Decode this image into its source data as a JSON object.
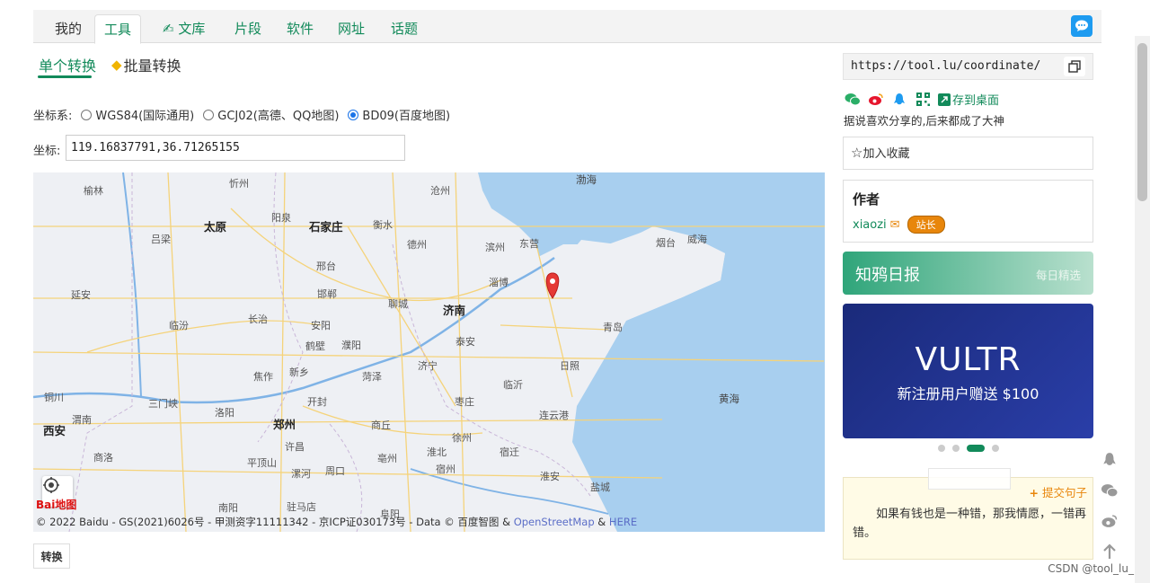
{
  "nav": {
    "tabs": [
      {
        "label": "我的",
        "state": "plain"
      },
      {
        "label": "工具",
        "state": "active"
      },
      {
        "label": "文库",
        "state": "link"
      },
      {
        "label": "片段",
        "state": "link"
      },
      {
        "label": "软件",
        "state": "link"
      },
      {
        "label": "网址",
        "state": "link"
      },
      {
        "label": "话题",
        "state": "link"
      }
    ]
  },
  "subtabs": {
    "single": "单个转换",
    "batch": "批量转换"
  },
  "coord_system": {
    "label": "坐标系:",
    "options": [
      {
        "label": "WGS84(国际通用)",
        "checked": false
      },
      {
        "label": "GCJ02(高德、QQ地图)",
        "checked": false
      },
      {
        "label": "BD09(百度地图)",
        "checked": true
      }
    ]
  },
  "coord": {
    "label": "坐标:",
    "value": "119.16837791,36.71265155"
  },
  "map": {
    "cities_major": [
      "太原",
      "石家庄",
      "济南",
      "郑州",
      "西安"
    ],
    "cities": [
      "榆林",
      "忻州",
      "阳泉",
      "衡水",
      "沧州",
      "德州",
      "滨州",
      "东营",
      "烟台",
      "威海",
      "吕梁",
      "邢台",
      "淄博",
      "延安",
      "临汾",
      "长治",
      "邯郸",
      "聊城",
      "安阳",
      "青岛",
      "鹤壁",
      "濮阳",
      "日照",
      "泰安",
      "济宁",
      "焦作",
      "新乡",
      "菏泽",
      "临沂",
      "铜川",
      "三门峡",
      "洛阳",
      "开封",
      "枣庄",
      "渭南",
      "商丘",
      "连云港",
      "淮北",
      "徐州",
      "宿迁",
      "许昌",
      "亳州",
      "宿州",
      "商洛",
      "平顶山",
      "漯河",
      "周口",
      "淮安",
      "盐城",
      "南阳",
      "驻马店",
      "阜阳"
    ],
    "seas": [
      "渤海",
      "黄海"
    ],
    "copyright": "© 2022 Baidu - GS(2021)6026号 - 甲测资字11111342 - 京ICP证030173号 - Data © 百度智图 & ",
    "osm": "OpenStreetMap",
    "amp": " & ",
    "here": "HERE",
    "logo": "Bai地图"
  },
  "convert_button": "转换",
  "share": {
    "url": "https://tool.lu/coordinate/",
    "save_label": "存到桌面",
    "tip": "据说喜欢分享的,后来都成了大神"
  },
  "favorite": "加入收藏",
  "author": {
    "title": "作者",
    "name": "xiaozi",
    "badge": "站长"
  },
  "daily": {
    "title": "知鸦日报",
    "sub": "每日精选"
  },
  "ad": {
    "title": "VULTR",
    "sub": "新注册用户赠送 $100"
  },
  "carousel": {
    "count": 4,
    "active_index": 2
  },
  "quote": {
    "submit": "提交句子",
    "text": "如果有钱也是一种错，那我情愿，一错再错。"
  },
  "watermark": "CSDN @tool_lu_",
  "colors": {
    "accent": "#128a5a",
    "badge": "#e8860b",
    "ad": "#1a2a7a"
  }
}
